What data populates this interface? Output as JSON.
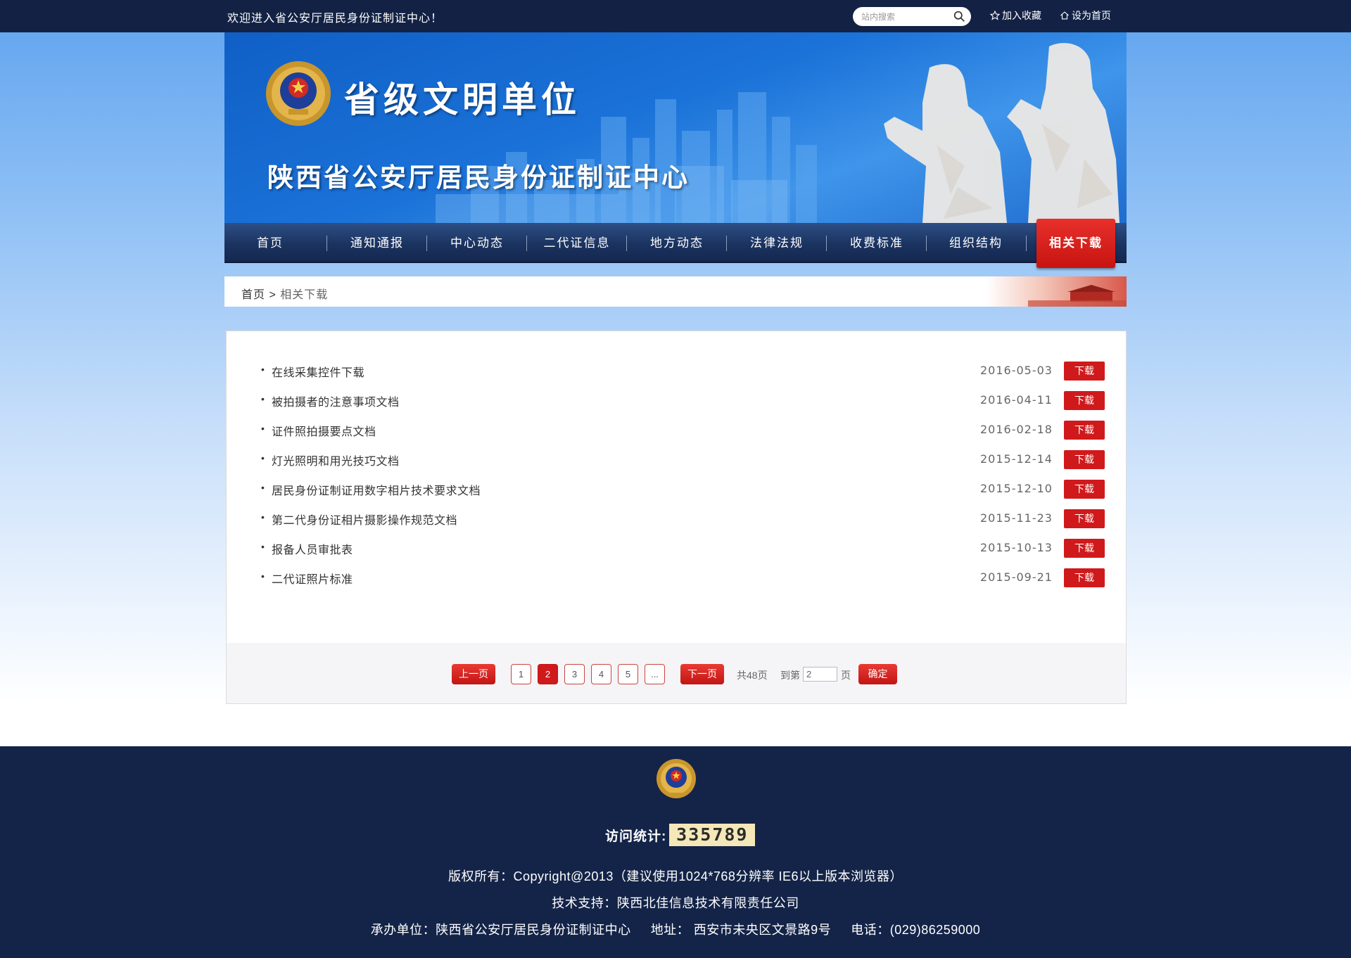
{
  "topbar": {
    "welcome": "欢迎进入省公安厅居民身份证制证中心！",
    "search_placeholder": "站内搜索",
    "favorite": "加入收藏",
    "set_home": "设为首页"
  },
  "banner": {
    "slogan": "省级文明单位",
    "site_name": "陕西省公安厅居民身份证制证中心"
  },
  "nav": {
    "items": [
      "首页",
      "通知通报",
      "中心动态",
      "二代证信息",
      "地方动态",
      "法律法规",
      "收费标准",
      "组织结构"
    ],
    "active": "相关下载"
  },
  "breadcrumb": {
    "home": "首页",
    "sep": ">",
    "current": "相关下载"
  },
  "downloads": [
    {
      "title": "在线采集控件下载",
      "date": "2016-05-03",
      "button": "下载"
    },
    {
      "title": "被拍摄者的注意事项文档",
      "date": "2016-04-11",
      "button": "下载"
    },
    {
      "title": "证件照拍摄要点文档",
      "date": "2016-02-18",
      "button": "下载"
    },
    {
      "title": "灯光照明和用光技巧文档",
      "date": "2015-12-14",
      "button": "下载"
    },
    {
      "title": "居民身份证制证用数字相片技术要求文档",
      "date": "2015-12-10",
      "button": "下载"
    },
    {
      "title": "第二代身份证相片摄影操作规范文档",
      "date": "2015-11-23",
      "button": "下载"
    },
    {
      "title": "报备人员审批表",
      "date": "2015-10-13",
      "button": "下载"
    },
    {
      "title": "二代证照片标准",
      "date": "2015-09-21",
      "button": "下载"
    }
  ],
  "pager": {
    "prev": "上一页",
    "pages": [
      "1",
      "2",
      "3",
      "4",
      "5",
      "..."
    ],
    "current_page": "2",
    "next": "下一页",
    "total": "共48页",
    "goto_label": "到第",
    "goto_value": "2",
    "page_unit": "页",
    "confirm": "确定"
  },
  "footer": {
    "visits_label": "访问统计:",
    "visits_count": "335789",
    "copyright": "版权所有：Copyright@2013（建议使用1024*768分辨率  IE6以上版本浏览器）",
    "support": "技术支持：陕西北佳信息技术有限责任公司",
    "organizer": "承办单位：陕西省公安厅居民身份证制证中心",
    "address": "地址： 西安市未央区文景路9号",
    "phone": "电话：(029)86259000"
  },
  "colors": {
    "topbar": "#132244",
    "nav": "#1b3360",
    "accent_red": "#d0191b",
    "footer": "#142448",
    "banner_blue": "#1b72d8"
  }
}
